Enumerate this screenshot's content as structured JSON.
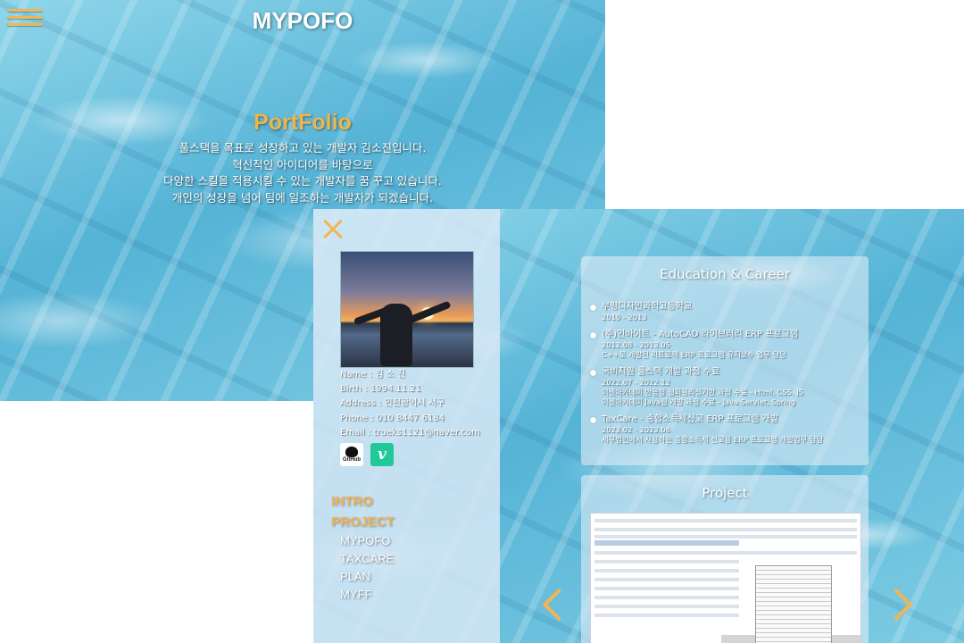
{
  "background_window": {
    "brand": "MYPOFO",
    "hero_title": "PortFolio",
    "hero_lines": [
      "풀스택을 목표로 성장하고 있는 개발자 김소진입니다.",
      "혁신적인 아이디어를 바탕으로",
      "다양한 스킬을 적용시킬 수 있는 개발자를 꿈 꾸고 있습니다.",
      "개인의 성장을 넘어 팀에 일조하는 개발자가 되겠습니다."
    ]
  },
  "sidebar": {
    "info": [
      "Name : 김 소 진",
      "Birth : 1994.11.21",
      "Address : 인천광역시 서구",
      "Phone : 010 8447 6184",
      "Email : trueks1121@naver.com"
    ],
    "social": {
      "github": "GitHub",
      "velog": "v"
    },
    "nav": {
      "intro": "INTRO",
      "project": "PROJECT",
      "sub": [
        "MYPOFO",
        "TAXCARE",
        "PLAN",
        "MYFF"
      ]
    }
  },
  "education": {
    "title": "Education & Career",
    "items": [
      {
        "name": "부평디자인과학고등학교",
        "details": [
          "2010 - 2013"
        ]
      },
      {
        "name": "(주)인바이트 - AutoCAD 라이브러리 ERP 프로그램",
        "details": [
          "2012.08 - 2013.05",
          "C++로 개발된 리프로젝 ERP 프로그램 유지보수 업무 담당"
        ]
      },
      {
        "name": "국비지원 풀스택 개발 과정 수료",
        "details": [
          "2022.07 - 2022.12",
          "이젠아카데미 반응형 웹퍼블리싱기반 과정 수료 - Html, CSS, JS",
          "이젠아카데미 Java웹 개발 과정 수료 - Java Servlet, Spring"
        ]
      },
      {
        "name": "TaxCare - 종합소득세신고 ERP 프로그램 개발",
        "details": [
          "2023.02 - 2023.06",
          "세무법인에서 사용하는 종합소득세 신고용 ERP 프로그램 개발업무 담당"
        ]
      }
    ]
  },
  "project": {
    "title": "Project"
  },
  "colors": {
    "accent": "#f2b455",
    "water": "#6cc0dc"
  },
  "icons": [
    "hamburger-icon",
    "close-icon",
    "github-icon",
    "velog-icon",
    "chevron-left-icon",
    "chevron-right-icon"
  ]
}
